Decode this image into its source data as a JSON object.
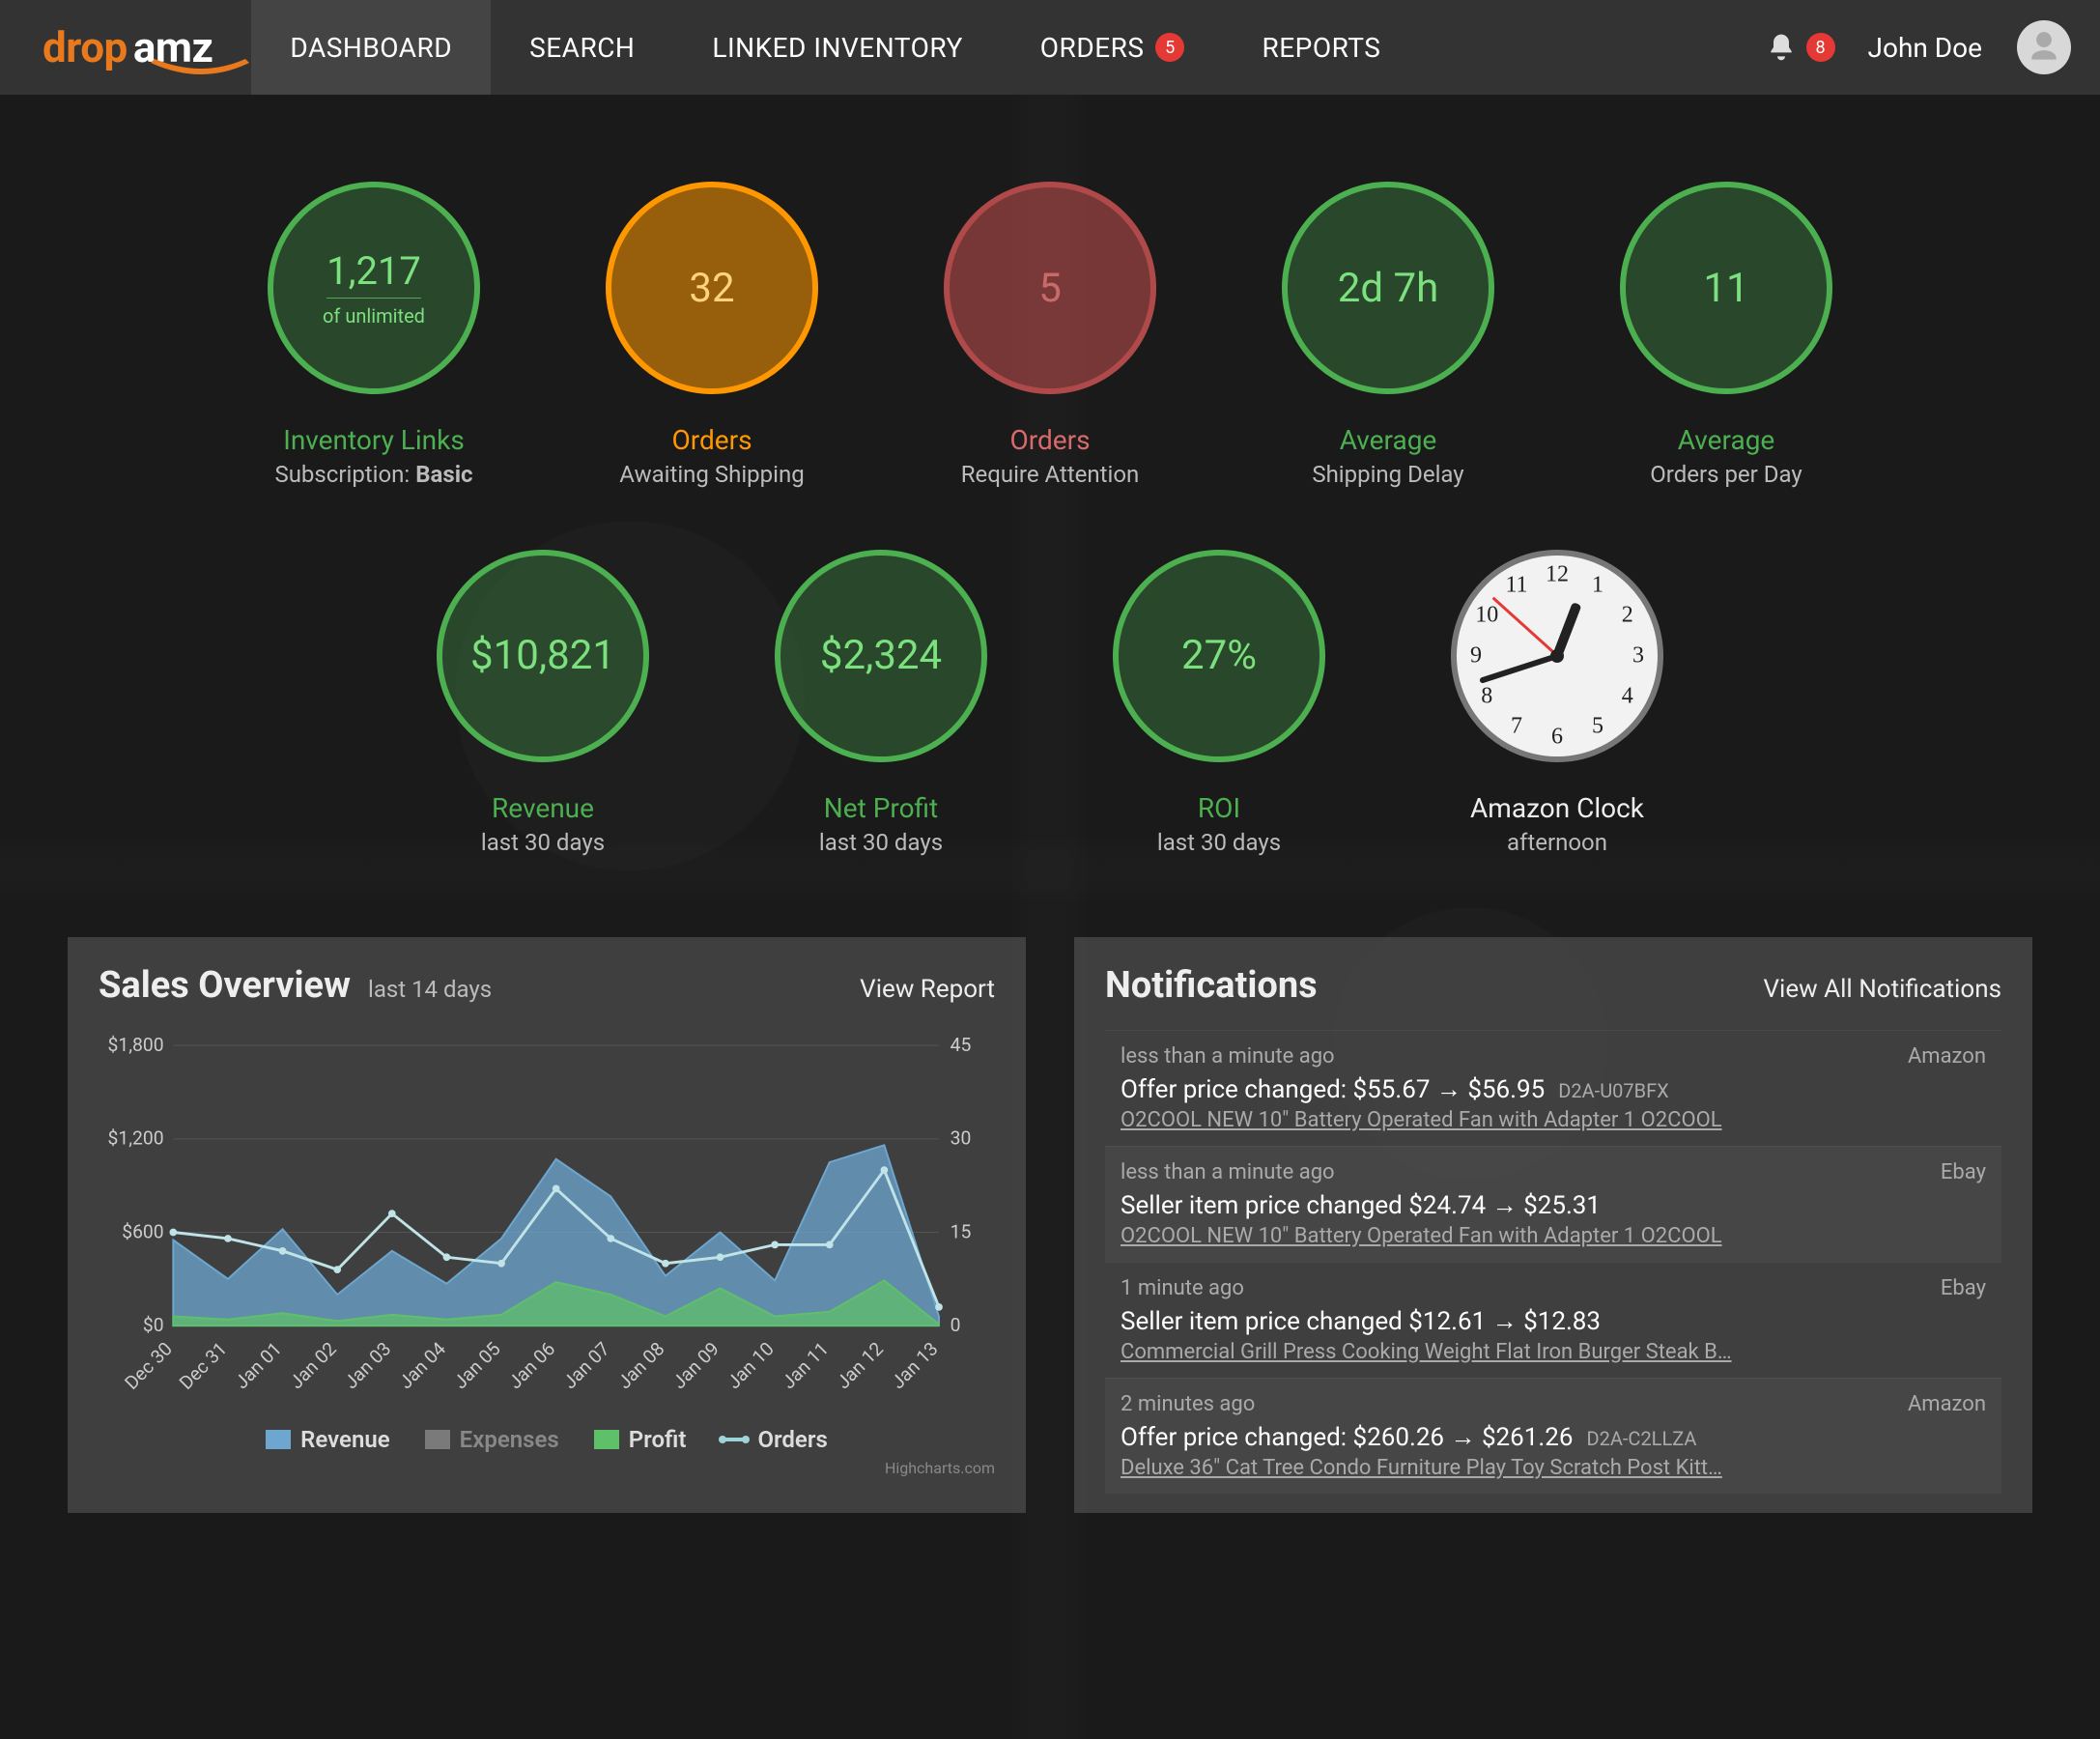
{
  "brand": {
    "part1": "drop",
    "part2": "amz"
  },
  "nav": {
    "items": [
      {
        "label": "DASHBOARD",
        "active": true
      },
      {
        "label": "SEARCH"
      },
      {
        "label": "LINKED INVENTORY"
      },
      {
        "label": "ORDERS",
        "badge": "5"
      },
      {
        "label": "REPORTS"
      }
    ],
    "notif_badge": "8",
    "user_name": "John Doe"
  },
  "stats_row1": [
    {
      "value": "1,217",
      "subvalue": "of unlimited",
      "color": "green",
      "label1": "Inventory Links",
      "label2_prefix": "Subscription: ",
      "label2_bold": "Basic",
      "lcolors": [
        "green-text",
        "white-text"
      ],
      "small_val": true
    },
    {
      "value": "32",
      "color": "orange",
      "label1": "Orders",
      "label2": "Awaiting Shipping",
      "lcolors": [
        "orange-text",
        "orange-text"
      ]
    },
    {
      "value": "5",
      "color": "red",
      "label1": "Orders",
      "label2": "Require Attention",
      "lcolors": [
        "red-text",
        "red-text"
      ]
    },
    {
      "value": "2d 7h",
      "color": "green",
      "label1": "Average",
      "label2": "Shipping Delay",
      "lcolors": [
        "green-text",
        "green-text"
      ]
    },
    {
      "value": "11",
      "color": "green",
      "label1": "Average",
      "label2": "Orders per Day",
      "lcolors": [
        "green-text",
        "green-text"
      ]
    }
  ],
  "stats_row2": [
    {
      "value": "$10,821",
      "color": "green",
      "label1": "Revenue",
      "label2": "last 30 days",
      "lcolors": [
        "green-text",
        "white-text"
      ]
    },
    {
      "value": "$2,324",
      "color": "green",
      "label1": "Net Profit",
      "label2": "last 30 days",
      "lcolors": [
        "green-text",
        "white-text"
      ]
    },
    {
      "value": "27%",
      "color": "green",
      "label1": "ROI",
      "label2": "last 30 days",
      "lcolors": [
        "green-text",
        "white-text"
      ]
    },
    {
      "is_clock": true,
      "label1": "Amazon Clock",
      "label2": "afternoon",
      "lcolors": [
        "white-text",
        "white-text"
      ]
    }
  ],
  "clock": {
    "hour": 12,
    "minute": 42,
    "second": 52
  },
  "sales_panel": {
    "title": "Sales Overview",
    "subtitle": "last 14 days",
    "link": "View Report",
    "credits": "Highcharts.com",
    "legend": [
      {
        "label": "Revenue",
        "fill": "#6da7d0",
        "type": "box"
      },
      {
        "label": "Expenses",
        "fill": "#7a7a7a",
        "type": "box",
        "dim": true
      },
      {
        "label": "Profit",
        "fill": "#5fc06a",
        "type": "box"
      },
      {
        "label": "Orders",
        "fill": "#9ed4d8",
        "type": "line"
      }
    ]
  },
  "chart_data": {
    "type": "area+line",
    "categories": [
      "Dec 30",
      "Dec 31",
      "Jan 01",
      "Jan 02",
      "Jan 03",
      "Jan 04",
      "Jan 05",
      "Jan 06",
      "Jan 07",
      "Jan 08",
      "Jan 09",
      "Jan 10",
      "Jan 11",
      "Jan 12",
      "Jan 13"
    ],
    "y_left": {
      "label": "$",
      "ticks": [
        0,
        600,
        1200,
        1800
      ]
    },
    "y_right": {
      "ticks": [
        0,
        15,
        30,
        45
      ]
    },
    "series": [
      {
        "name": "Revenue",
        "axis": "left",
        "values": [
          550,
          300,
          620,
          200,
          480,
          270,
          560,
          1070,
          830,
          320,
          600,
          290,
          1050,
          1160,
          60
        ]
      },
      {
        "name": "Profit",
        "axis": "left",
        "values": [
          60,
          40,
          80,
          30,
          70,
          40,
          70,
          280,
          200,
          60,
          240,
          60,
          90,
          290,
          10
        ]
      },
      {
        "name": "Orders",
        "axis": "right",
        "values": [
          15,
          14,
          12,
          9,
          18,
          11,
          10,
          22,
          14,
          10,
          11,
          13,
          13,
          25,
          3
        ]
      }
    ]
  },
  "notif_panel": {
    "title": "Notifications",
    "link": "View All Notifications",
    "items": [
      {
        "time": "less than a minute ago",
        "source": "Amazon",
        "title": "Offer price changed: $55.67 → $56.95",
        "code": "D2A-U07BFX",
        "link": "O2COOL NEW 10\" Battery Operated Fan with Adapter 1 O2COOL"
      },
      {
        "time": "less than a minute ago",
        "source": "Ebay",
        "title": "Seller item price changed $24.74 → $25.31",
        "code": "",
        "link": "O2COOL NEW 10\" Battery Operated Fan with Adapter 1 O2COOL"
      },
      {
        "time": "1 minute ago",
        "source": "Ebay",
        "title": "Seller item price changed $12.61 → $12.83",
        "code": "",
        "link": "Commercial Grill Press Cooking Weight Flat Iron Burger Steak B…"
      },
      {
        "time": "2 minutes ago",
        "source": "Amazon",
        "title": "Offer price changed: $260.26 → $261.26",
        "code": "D2A-C2LLZA",
        "link": "Deluxe 36\" Cat Tree Condo Furniture Play Toy Scratch Post Kitt…"
      }
    ]
  }
}
